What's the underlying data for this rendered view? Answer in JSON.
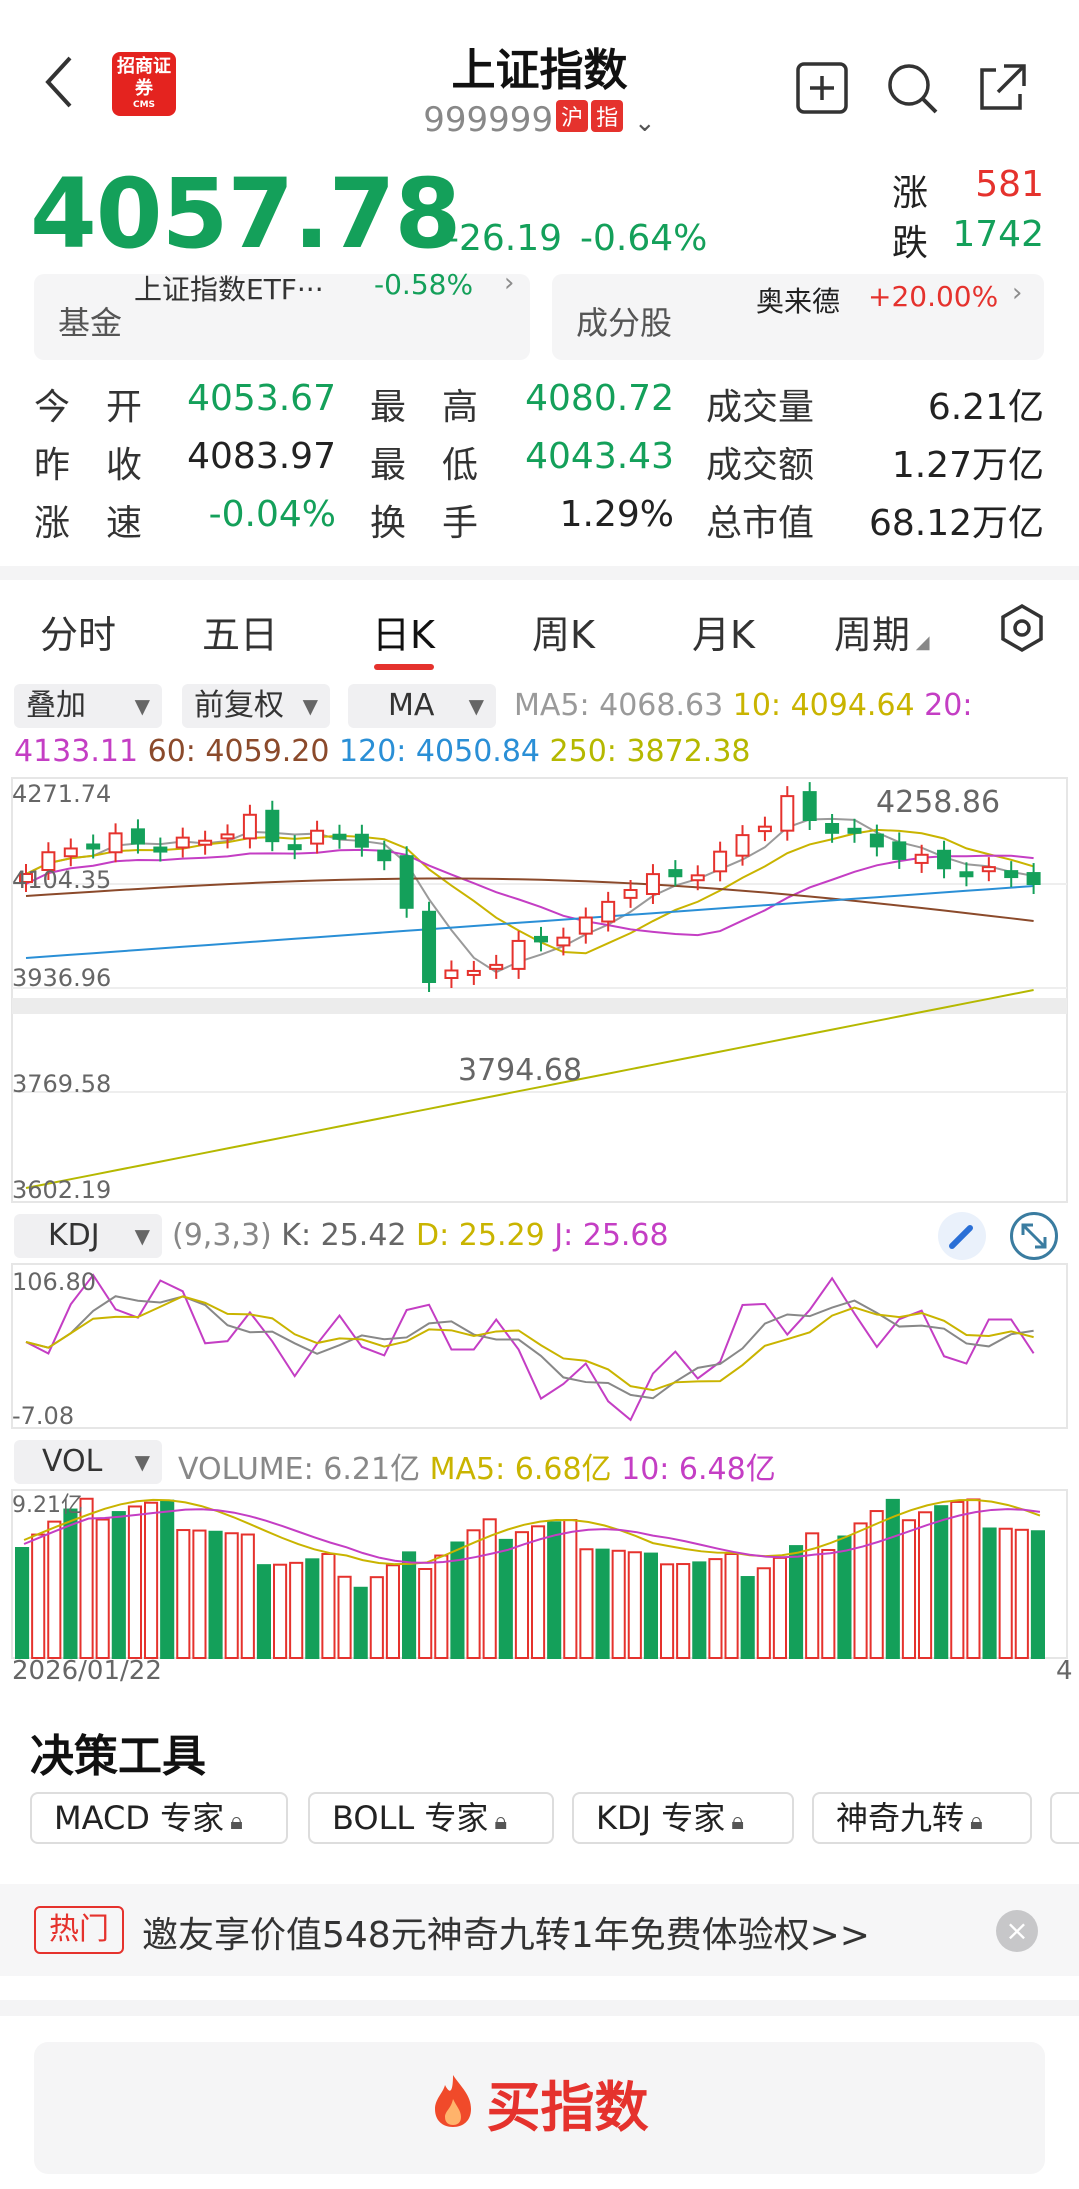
{
  "header": {
    "title": "上证指数",
    "code": "999999",
    "market_tag_1": "沪",
    "market_tag_2": "指",
    "logo_text": "招商证券",
    "logo_sub": "CMS"
  },
  "quote": {
    "price": "4057.78",
    "change": "-26.19",
    "change_pct": "-0.64%",
    "up_label": "涨",
    "up_count": "581",
    "down_label": "跌",
    "down_count": "1742"
  },
  "cards": {
    "fund_label": "基金",
    "fund_name": "上证指数ETF···",
    "fund_pct": "-0.58%",
    "constituent_label": "成分股",
    "constituent_name": "奥来德",
    "constituent_pct": "+20.00%"
  },
  "stats": [
    {
      "label": "今　开",
      "value": "4053.67",
      "color": "green"
    },
    {
      "label": "最　高",
      "value": "4080.72",
      "color": "green"
    },
    {
      "label": "成交量",
      "value": "6.21亿",
      "color": "black"
    },
    {
      "label": "昨　收",
      "value": "4083.97",
      "color": "black"
    },
    {
      "label": "最　低",
      "value": "4043.43",
      "color": "green"
    },
    {
      "label": "成交额",
      "value": "1.27万亿",
      "color": "black"
    },
    {
      "label": "涨　速",
      "value": "-0.04%",
      "color": "green"
    },
    {
      "label": "换　手",
      "value": "1.29%",
      "color": "black"
    },
    {
      "label": "总市值",
      "value": "68.12万亿",
      "color": "black"
    }
  ],
  "tabs": [
    "分时",
    "五日",
    "日K",
    "周K",
    "月K",
    "周期"
  ],
  "active_tab": "日K",
  "controls": {
    "overlay": "叠加",
    "adjust": "前复权",
    "indicator": "MA",
    "ma5": "MA5: 4068.63",
    "ma10": "10: 4094.64",
    "ma20": "20:",
    "ma20_val": "4133.11",
    "ma60": "60: 4059.20",
    "ma120": "120: 4050.84",
    "ma250": "250: 3872.38"
  },
  "kchart": {
    "y_labels": [
      "4271.74",
      "4104.35",
      "3936.96",
      "3769.58",
      "3602.19"
    ],
    "high_label": "4258.86",
    "low_label": "3794.68"
  },
  "kdj": {
    "name": "KDJ",
    "params": "(9,3,3)",
    "k": "K: 25.42",
    "d": "D: 25.29",
    "j": "J: 25.68",
    "y_top": "106.80",
    "y_bottom": "-7.08"
  },
  "vol": {
    "name": "VOL",
    "volume": "VOLUME: 6.21亿",
    "ma5": "MA5: 6.68亿",
    "ma10": "10: 6.48亿",
    "y_top": "9.21亿",
    "date_start": "2026/01/22",
    "date_end": "4"
  },
  "tools": {
    "title": "决策工具",
    "chips": [
      "MACD 专家",
      "BOLL 专家",
      "KDJ 专家",
      "神奇九转"
    ]
  },
  "banner": {
    "tag": "热门",
    "text": "邀友享价值548元神奇九转1年免费体验权>>"
  },
  "buy_button": "买指数",
  "colors": {
    "up": "#e5322d",
    "down": "#14a05a",
    "ma5": "#9a9a9a",
    "ma10": "#c9b400",
    "ma20": "#c43ec4",
    "ma60": "#8b4a2b",
    "ma120": "#2a8fd6",
    "ma250": "#b5b800"
  }
}
